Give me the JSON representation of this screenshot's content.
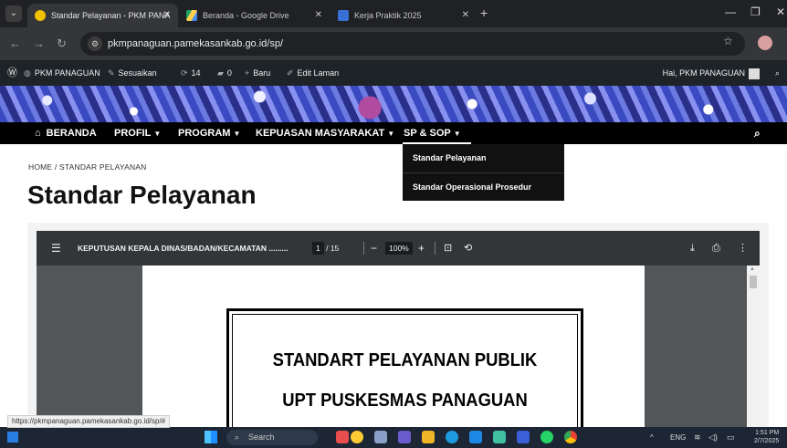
{
  "browser": {
    "tabs": [
      {
        "label": "Standar Pelayanan - PKM PANA",
        "active": true
      },
      {
        "label": "Beranda - Google Drive",
        "active": false
      },
      {
        "label": "Kerja Praktik 2025",
        "active": false
      }
    ],
    "url": "pkmpanaguan.pamekasankab.go.id/sp/"
  },
  "adminbar": {
    "site": "PKM PANAGUAN",
    "customize": "Sesuaikan",
    "updates": "14",
    "comments": "0",
    "new": "Baru",
    "edit": "Edit Laman",
    "greeting": "Hai, PKM PANAGUAN"
  },
  "nav": {
    "items": [
      "BERANDA",
      "PROFIL",
      "PROGRAM",
      "KEPUASAN MASYARAKAT",
      "SP & SOP"
    ]
  },
  "dropdown": {
    "items": [
      "Standar Pelayanan",
      "Standar Operasional Prosedur"
    ]
  },
  "page": {
    "breadcrumb": "HOME / STANDAR PELAYANAN",
    "title": "Standar Pelayanan"
  },
  "pdf": {
    "doc_title": "KEPUTUSAN KEPALA DINAS/BADAN/KECAMATAN .........",
    "page_current": "1",
    "page_total": "/ 15",
    "zoom": "100%",
    "heading_line1": "STANDART PELAYANAN PUBLIK",
    "heading_line2": "UPT PUSKESMAS PANAGUAN"
  },
  "status_url": "https://pkmpanaguan.pamekasankab.go.id/sp/#",
  "taskbar": {
    "search": "Search",
    "lang": "ENG",
    "time": "1:51 PM",
    "date": "2/7/2025"
  },
  "colors": {
    "accent": "#000000",
    "admin_bg": "#1d2327",
    "pdf_toolbar": "#323639"
  }
}
